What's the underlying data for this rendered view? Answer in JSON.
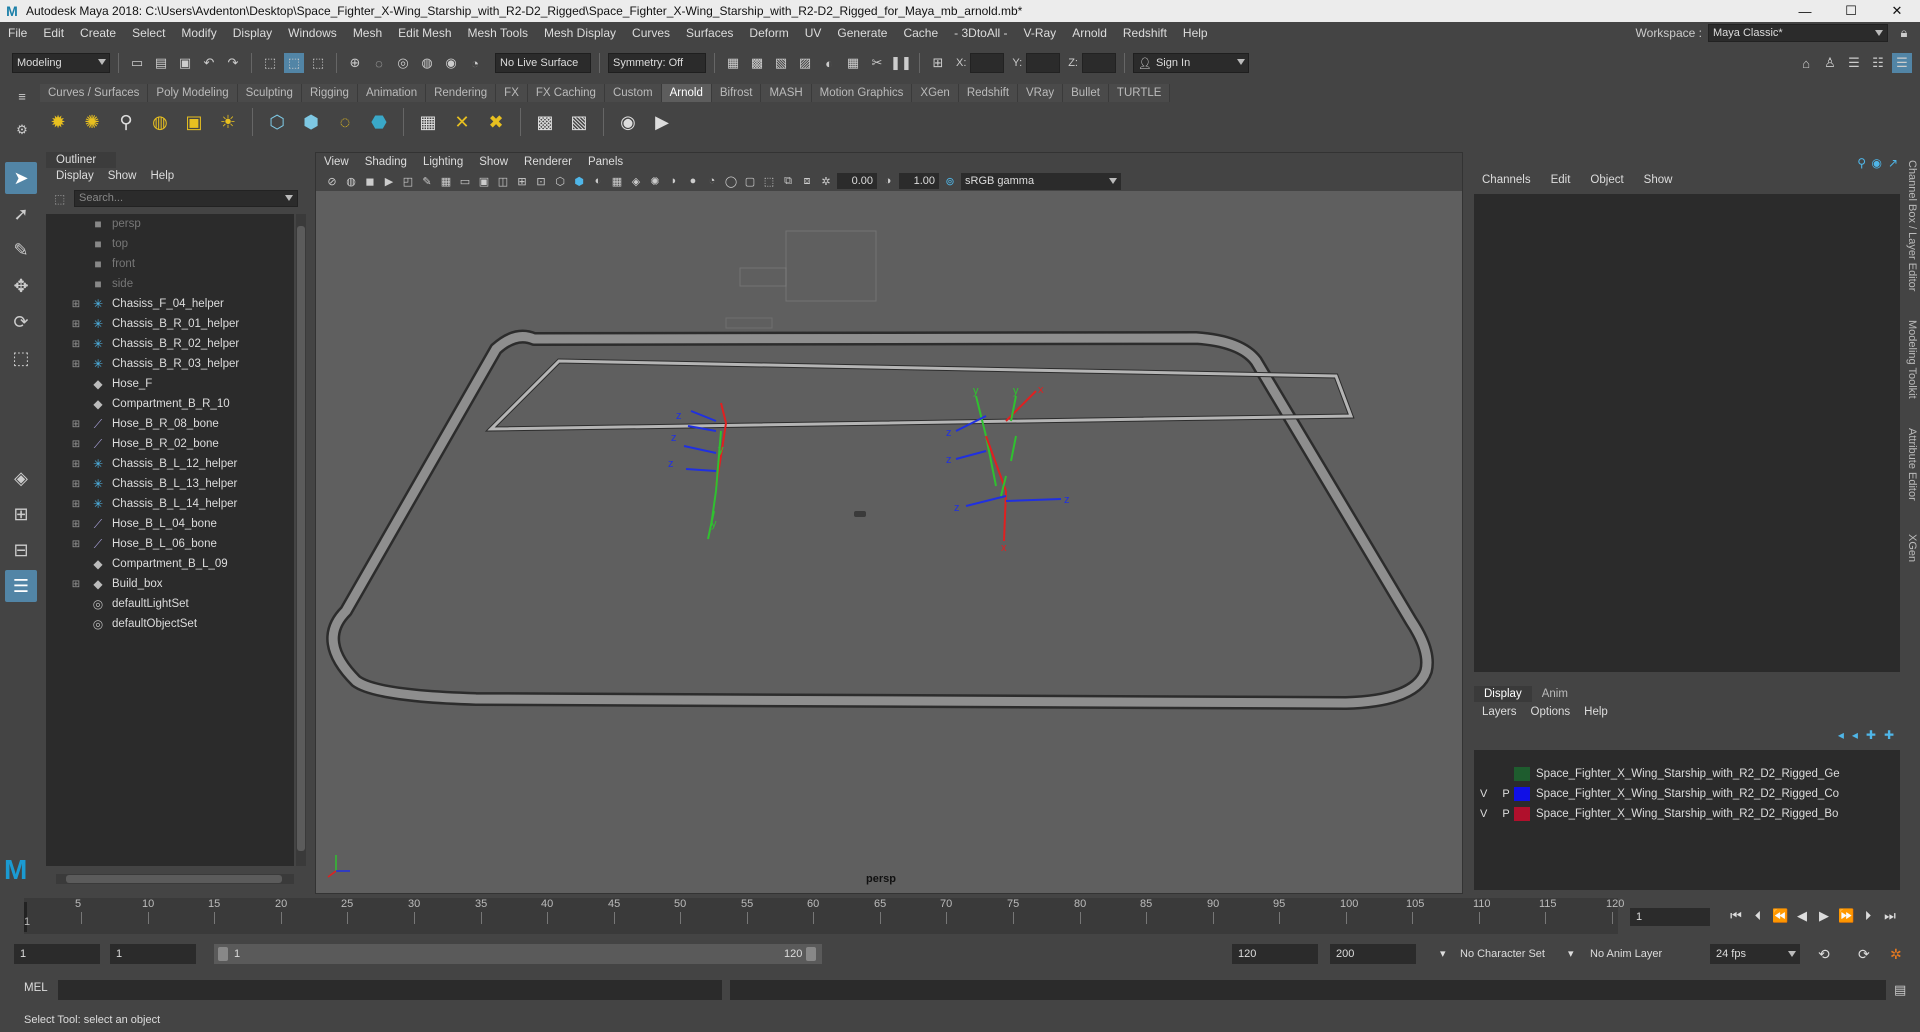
{
  "window": {
    "title": "Autodesk Maya 2018: C:\\Users\\Avdenton\\Desktop\\Space_Fighter_X-Wing_Starship_with_R2-D2_Rigged\\Space_Fighter_X-Wing_Starship_with_R2-D2_Rigged_for_Maya_mb_arnold.mb*",
    "logo": "M",
    "min": "—",
    "max": "☐",
    "close": "✕"
  },
  "menubar": {
    "items": [
      "File",
      "Edit",
      "Create",
      "Select",
      "Modify",
      "Display",
      "Windows",
      "Mesh",
      "Edit Mesh",
      "Mesh Tools",
      "Mesh Display",
      "Curves",
      "Surfaces",
      "Deform",
      "UV",
      "Generate",
      "Cache",
      "- 3DtoAll -",
      "V-Ray",
      "Arnold",
      "Redshift",
      "Help"
    ],
    "workspace_label": "Workspace :",
    "workspace_value": "Maya Classic*"
  },
  "statusline": {
    "mode": "Modeling",
    "live_surface": "No Live Surface",
    "symmetry": "Symmetry: Off",
    "x_label": "X:",
    "y_label": "Y:",
    "z_label": "Z:",
    "sign_in": "Sign In"
  },
  "shelf": {
    "tabs": [
      "Curves / Surfaces",
      "Poly Modeling",
      "Sculpting",
      "Rigging",
      "Animation",
      "Rendering",
      "FX",
      "FX Caching",
      "Custom",
      "Arnold",
      "Bifrost",
      "MASH",
      "Motion Graphics",
      "XGen",
      "Redshift",
      "VRay",
      "Bullet",
      "TURTLE"
    ],
    "active_tab": "Arnold"
  },
  "outliner": {
    "title": "Outliner",
    "menu": [
      "Display",
      "Show",
      "Help"
    ],
    "search_placeholder": "Search...",
    "items": [
      {
        "label": "persp",
        "icon": "camera-icon",
        "expand": "",
        "dim": true
      },
      {
        "label": "top",
        "icon": "camera-icon",
        "expand": "",
        "dim": true
      },
      {
        "label": "front",
        "icon": "camera-icon",
        "expand": "",
        "dim": true
      },
      {
        "label": "side",
        "icon": "camera-icon",
        "expand": "",
        "dim": true
      },
      {
        "label": "Chasiss_F_04_helper",
        "icon": "locator-icon",
        "expand": "⊞",
        "dim": false
      },
      {
        "label": "Chassis_B_R_01_helper",
        "icon": "locator-icon",
        "expand": "⊞",
        "dim": false
      },
      {
        "label": "Chassis_B_R_02_helper",
        "icon": "locator-icon",
        "expand": "⊞",
        "dim": false
      },
      {
        "label": "Chassis_B_R_03_helper",
        "icon": "locator-icon",
        "expand": "⊞",
        "dim": false
      },
      {
        "label": "Hose_F",
        "icon": "transform-icon",
        "expand": "",
        "dim": false
      },
      {
        "label": "Compartment_B_R_10",
        "icon": "transform-icon",
        "expand": "",
        "dim": false
      },
      {
        "label": "Hose_B_R_08_bone",
        "icon": "joint-icon",
        "expand": "⊞",
        "dim": false
      },
      {
        "label": "Hose_B_R_02_bone",
        "icon": "joint-icon",
        "expand": "⊞",
        "dim": false
      },
      {
        "label": "Chassis_B_L_12_helper",
        "icon": "locator-icon",
        "expand": "⊞",
        "dim": false
      },
      {
        "label": "Chassis_B_L_13_helper",
        "icon": "locator-icon",
        "expand": "⊞",
        "dim": false
      },
      {
        "label": "Chassis_B_L_14_helper",
        "icon": "locator-icon",
        "expand": "⊞",
        "dim": false
      },
      {
        "label": "Hose_B_L_04_bone",
        "icon": "joint-icon",
        "expand": "⊞",
        "dim": false
      },
      {
        "label": "Hose_B_L_06_bone",
        "icon": "joint-icon",
        "expand": "⊞",
        "dim": false
      },
      {
        "label": "Compartment_B_L_09",
        "icon": "transform-icon",
        "expand": "",
        "dim": false
      },
      {
        "label": "Build_box",
        "icon": "transform-icon",
        "expand": "⊞",
        "dim": false
      },
      {
        "label": "defaultLightSet",
        "icon": "set-icon",
        "expand": "",
        "dim": false
      },
      {
        "label": "defaultObjectSet",
        "icon": "set-icon",
        "expand": "",
        "dim": false
      }
    ]
  },
  "viewport": {
    "menu": [
      "View",
      "Shading",
      "Lighting",
      "Show",
      "Renderer",
      "Panels"
    ],
    "exposure": "0.00",
    "gamma": "1.00",
    "color_space": "sRGB gamma",
    "camera_label": "persp"
  },
  "channelbox": {
    "menu": [
      "Channels",
      "Edit",
      "Object",
      "Show"
    ],
    "layer_tabs": [
      "Display",
      "Anim"
    ],
    "layer_menu": [
      "Layers",
      "Options",
      "Help"
    ],
    "layers": [
      {
        "vp": "",
        "name": "Space_Fighter_X_Wing_Starship_with_R2_D2_Rigged_Ge",
        "color": "#1e5c2e"
      },
      {
        "vp": "V P",
        "name": "Space_Fighter_X_Wing_Starship_with_R2_D2_Rigged_Co",
        "color": "#1010e6"
      },
      {
        "vp": "V P",
        "name": "Space_Fighter_X_Wing_Starship_with_R2_D2_Rigged_Bo",
        "color": "#b0102c"
      }
    ]
  },
  "sidestrip": {
    "labels": [
      "Channel Box / Layer Editor",
      "Modeling Toolkit",
      "Attribute Editor",
      "XGen"
    ]
  },
  "timeline": {
    "ticks": [
      "5",
      "10",
      "15",
      "20",
      "25",
      "30",
      "35",
      "40",
      "45",
      "50",
      "55",
      "60",
      "65",
      "70",
      "75",
      "80",
      "85",
      "90",
      "95",
      "100",
      "105",
      "110",
      "115",
      "120"
    ],
    "start_label": "1",
    "current_frame": "1"
  },
  "range": {
    "start": "1",
    "playback_start": "1",
    "slider_start": "1",
    "slider_end": "120",
    "playback_end": "120",
    "end": "200",
    "character_set": "No Character Set",
    "anim_layer": "No Anim Layer",
    "fps": "24 fps"
  },
  "cmdline": {
    "label": "MEL"
  },
  "helpline": {
    "text": "Select Tool: select an object"
  }
}
